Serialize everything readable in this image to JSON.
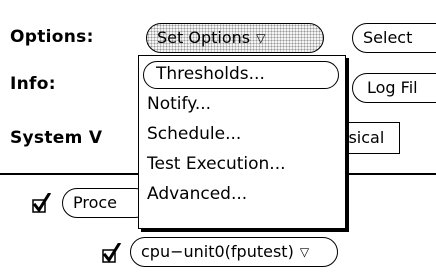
{
  "form": {
    "options_label": "Options:",
    "info_label": "Info:",
    "system_view_label": "System V",
    "set_options_label": "Set Options",
    "select_label": "Select",
    "log_files_label": "Log Fil",
    "physical_label": "ysical",
    "processors_label": "Proce",
    "cpu_unit_label": "cpu−unit0(fputest)",
    "dropdown_glyph": "▽"
  },
  "menu": {
    "items": [
      {
        "label": "Thresholds...",
        "highlighted": true
      },
      {
        "label": "Notify..."
      },
      {
        "label": "Schedule..."
      },
      {
        "label": "Test Execution..."
      },
      {
        "label": "Advanced..."
      }
    ]
  },
  "checks": {
    "processors_checked": true,
    "cpu_unit_checked": true
  }
}
